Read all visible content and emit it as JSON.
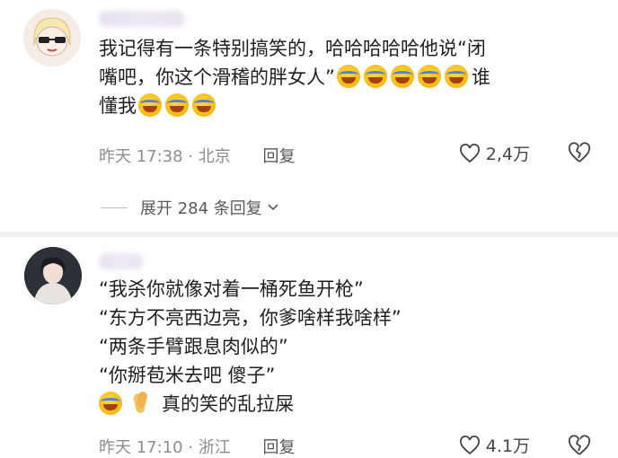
{
  "comments": [
    {
      "lines": [
        "我记得有一条特别搞笑的，哈哈哈哈哈他说“闭",
        "嘴吧，你这个滑稽的胖女人”",
        "懂我"
      ],
      "emoji_after_line2": [
        "laugh-cry",
        "laugh-cry",
        "laugh-cry",
        "laugh-cry",
        "laugh-cry"
      ],
      "line2_suffix": "谁",
      "emoji_after_line3": [
        "laugh-cry",
        "laugh-cry",
        "laugh-cry"
      ],
      "time": "昨天 17:38",
      "location": "北京",
      "reply_label": "回复",
      "likes": "2,4万"
    },
    {
      "lines": [
        "“我杀你就像对着一桶死鱼开枪”",
        "“东方不亮西边亮，你爹啥样我啥样”",
        "“两条手臂跟息肉似的”",
        "“你掰苞米去吧 傻子”"
      ],
      "last_line_text": "真的笑的乱拉屎",
      "time": "昨天 17:10",
      "location": "浙江",
      "reply_label": "回复",
      "likes": "4.1万"
    }
  ],
  "expand": {
    "label": "展开 284 条回复"
  },
  "colors": {
    "meta": "#8d8d8d",
    "text": "#1f1f1f",
    "divider": "#f2f2f2"
  }
}
